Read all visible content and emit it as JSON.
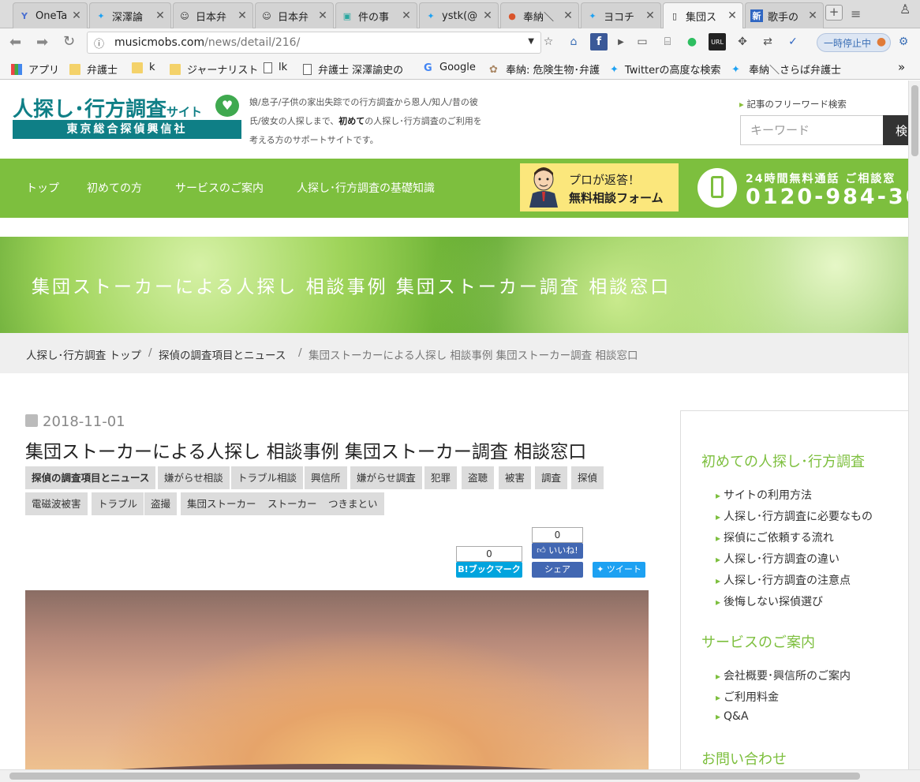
{
  "browser": {
    "tabs": [
      {
        "icon": "Y",
        "title": "OneTa",
        "active": false
      },
      {
        "icon": "t",
        "title": "深澤論",
        "active": false
      },
      {
        "icon": "b",
        "title": "日本弁",
        "active": false
      },
      {
        "icon": "b",
        "title": "日本弁",
        "active": false
      },
      {
        "icon": "c",
        "title": "件の事",
        "active": false
      },
      {
        "icon": "t",
        "title": "ystk(@",
        "active": false
      },
      {
        "icon": "r",
        "title": "奉納＼",
        "active": false
      },
      {
        "icon": "t",
        "title": "ヨコチ",
        "active": false
      },
      {
        "icon": "d",
        "title": "集団ス",
        "active": true
      },
      {
        "icon": "n",
        "title": "歌手の",
        "active": false
      }
    ],
    "url_host": "musicmobs.com",
    "url_path": "/news/detail/216/",
    "pause_label": "一時停止中",
    "bookmarks": [
      {
        "type": "apps",
        "label": "アプリ"
      },
      {
        "type": "folder",
        "label": "弁護士"
      },
      {
        "type": "folder",
        "label": "k"
      },
      {
        "type": "folder",
        "label": "ジャーナリスト"
      },
      {
        "type": "doc",
        "label": "lk"
      },
      {
        "type": "doc",
        "label": "弁護士 深澤諭史の"
      },
      {
        "type": "google",
        "label": "Google"
      },
      {
        "type": "site",
        "label": "奉納: 危険生物･弁護"
      },
      {
        "type": "twitter",
        "label": "Twitterの高度な検索"
      },
      {
        "type": "twitter",
        "label": "奉納＼さらば弁護士"
      }
    ],
    "bookmarks_more": "»"
  },
  "site": {
    "logo_main": "人探し･行方調査",
    "logo_small": "サイト",
    "logo_company": "東京総合探偵興信社",
    "tagline_a": "娘/息子/子供の家出失踪での行方調査から恩人/知人/昔の彼氏/彼女の人探しまで、",
    "tagline_bold": "初めて",
    "tagline_b": "の人探し･行方調査のご利用を考える方のサポートサイトです。",
    "search_label": "記事のフリーワード検索",
    "search_placeholder": "キーワード",
    "search_button": "検",
    "nav": [
      "トップ",
      "初めての方",
      "サービスのご案内",
      "人探し･行方調査の基礎知識"
    ],
    "consult_line1": "プロが返答！",
    "consult_line2": "無料相談フォーム",
    "free_call": "24時間無料通話 ご相談窓",
    "phone": "0120-984-30"
  },
  "hero": {
    "title": "集団ストーカーによる人探し 相談事例 集団ストーカー調査 相談窓口"
  },
  "breadcrumb": {
    "items": [
      "人探し･行方調査 トップ",
      "探偵の調査項目とニュース",
      "集団ストーカーによる人探し 相談事例 集団ストーカー調査 相談窓口"
    ],
    "separator": "/"
  },
  "article": {
    "date": "2018-11-01",
    "title": "集団ストーカーによる人探し 相談事例 集団ストーカー調査 相談窓口",
    "tags": [
      "探偵の調査項目とニュース",
      "嫌がらせ相談",
      "トラブル相談",
      "興信所",
      "嫌がらせ調査",
      "犯罪",
      "盗聴",
      "被害",
      "調査",
      "探偵",
      "電磁波被害",
      "トラブル",
      "盗撮",
      "集団ストーカー",
      "ストーカー",
      "つきまとい"
    ],
    "share": {
      "hatena_count": "0",
      "hatena_label": "B!ブックマーク",
      "fb_count": "0",
      "fb_like_label": "いいね!",
      "fb_share_label": "シェア",
      "tweet_label": "ツイート"
    }
  },
  "sidebar": {
    "section1_title": "初めての人探し･行方調査",
    "section1_items": [
      "サイトの利用方法",
      "人探し･行方調査に必要なもの",
      "探偵にご依頼する流れ",
      "人探し･行方調査の違い",
      "人探し･行方調査の注意点",
      "後悔しない探偵選び"
    ],
    "section2_title": "サービスのご案内",
    "section2_items": [
      "会社概要･興信所のご案内",
      "ご利用料金",
      "Q&A"
    ],
    "section3_title": "お問い合わせ"
  },
  "colors": {
    "brand_teal": "#0f7f86",
    "nav_green": "#7dbf3e",
    "consult_yellow": "#fbe77c"
  }
}
